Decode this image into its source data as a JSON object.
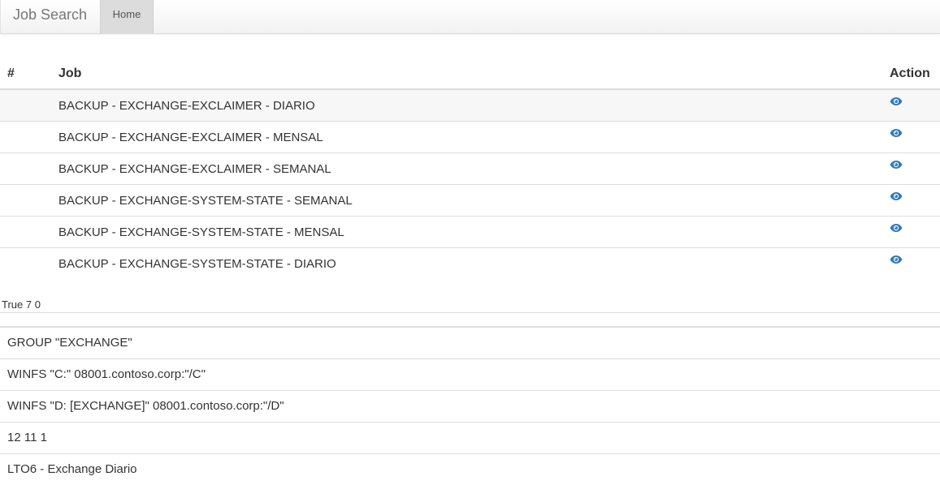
{
  "navbar": {
    "brand": "Job Search",
    "home_label": "Home"
  },
  "jobs_table": {
    "headers": {
      "number": "#",
      "job": "Job",
      "action": "Action"
    },
    "rows": [
      {
        "number": "",
        "job": "BACKUP - EXCHANGE-EXCLAIMER - DIARIO",
        "action_icon": "eye-icon"
      },
      {
        "number": "",
        "job": "BACKUP - EXCHANGE-EXCLAIMER - MENSAL",
        "action_icon": "eye-icon"
      },
      {
        "number": "",
        "job": "BACKUP - EXCHANGE-EXCLAIMER - SEMANAL",
        "action_icon": "eye-icon"
      },
      {
        "number": "",
        "job": "BACKUP - EXCHANGE-SYSTEM-STATE - SEMANAL",
        "action_icon": "eye-icon"
      },
      {
        "number": "",
        "job": "BACKUP - EXCHANGE-SYSTEM-STATE - MENSAL",
        "action_icon": "eye-icon"
      },
      {
        "number": "",
        "job": "BACKUP - EXCHANGE-SYSTEM-STATE - DIARIO",
        "action_icon": "eye-icon"
      }
    ]
  },
  "status_text": "True 7 0",
  "details": [
    "GROUP \"EXCHANGE\"",
    "WINFS \"C:\" 08001.contoso.corp:\"/C\"",
    "WINFS \"D: [EXCHANGE]\" 08001.contoso.corp:\"/D\"",
    "12 11 1",
    "LTO6 - Exchange Diario"
  ],
  "colors": {
    "icon_blue": "#337ab7",
    "navbar_active": "#dcdcdc",
    "row_stripe": "#f7f7f7"
  }
}
